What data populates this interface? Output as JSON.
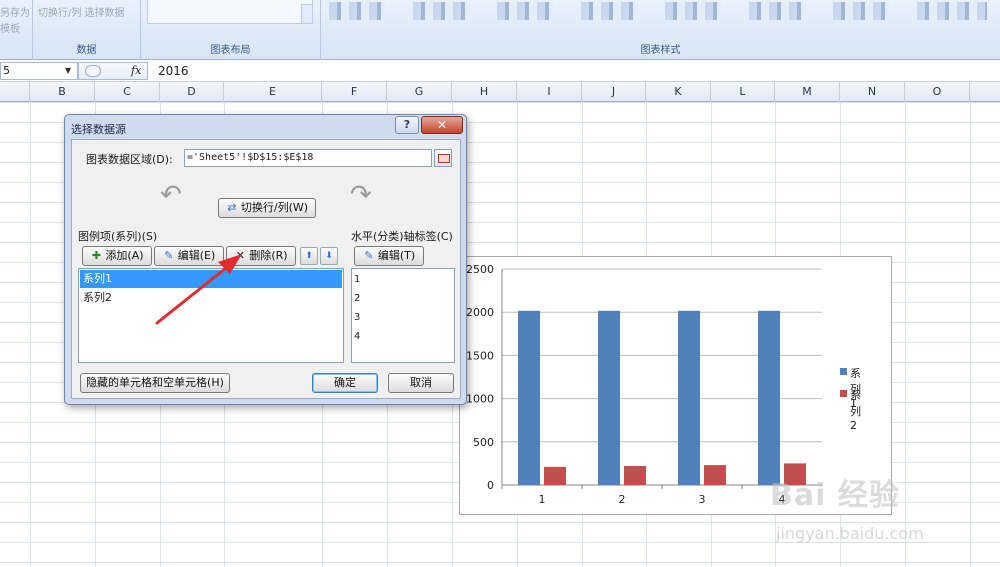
{
  "ribbon": {
    "save_as_template_line1": "另存为",
    "save_as_template_line2": "模板",
    "data_group_buttons": "切换行/列  选择数据",
    "data_group_label": "数据",
    "layout_group_label": "图表布局",
    "styles_group_label": "图表样式"
  },
  "formula_bar": {
    "name_box": "5",
    "fx_label": "fx",
    "value": "2016"
  },
  "columns": [
    "B",
    "C",
    "D",
    "E",
    "F",
    "G",
    "H",
    "I",
    "J",
    "K",
    "L",
    "M",
    "N",
    "O"
  ],
  "dialog": {
    "title": "选择数据源",
    "help": "?",
    "close": "✕",
    "range_label": "图表数据区域(D):",
    "range_value": "='Sheet5'!$D$15:$E$18",
    "switch_button": "切换行/列(W)",
    "series_header": "图例项(系列)(S)",
    "add_button": "添加(A)",
    "edit_button": "编辑(E)",
    "delete_button": "删除(R)",
    "up_arrow": "⬆",
    "down_arrow": "⬇",
    "series": [
      "系列1",
      "系列2"
    ],
    "axis_header": "水平(分类)轴标签(C)",
    "axis_edit_button": "编辑(T)",
    "axis_labels": [
      "1",
      "2",
      "3",
      "4"
    ],
    "hidden_cells_button": "隐藏的单元格和空单元格(H)",
    "ok_button": "确定",
    "cancel_button": "取消"
  },
  "chart_data": {
    "type": "bar",
    "categories": [
      "1",
      "2",
      "3",
      "4"
    ],
    "series": [
      {
        "name": "系列1",
        "color": "#4f81bd",
        "values": [
          2016,
          2016,
          2016,
          2016
        ]
      },
      {
        "name": "系列2",
        "color": "#c0504d",
        "values": [
          210,
          220,
          230,
          250
        ]
      }
    ],
    "ylim": [
      0,
      2500
    ],
    "yticks": [
      "0",
      "500",
      "1000",
      "1500",
      "2000",
      "2500"
    ],
    "grid": true,
    "legend": "right"
  },
  "watermark": {
    "main": "Bai 经验",
    "sub": "jingyan.baidu.com"
  }
}
